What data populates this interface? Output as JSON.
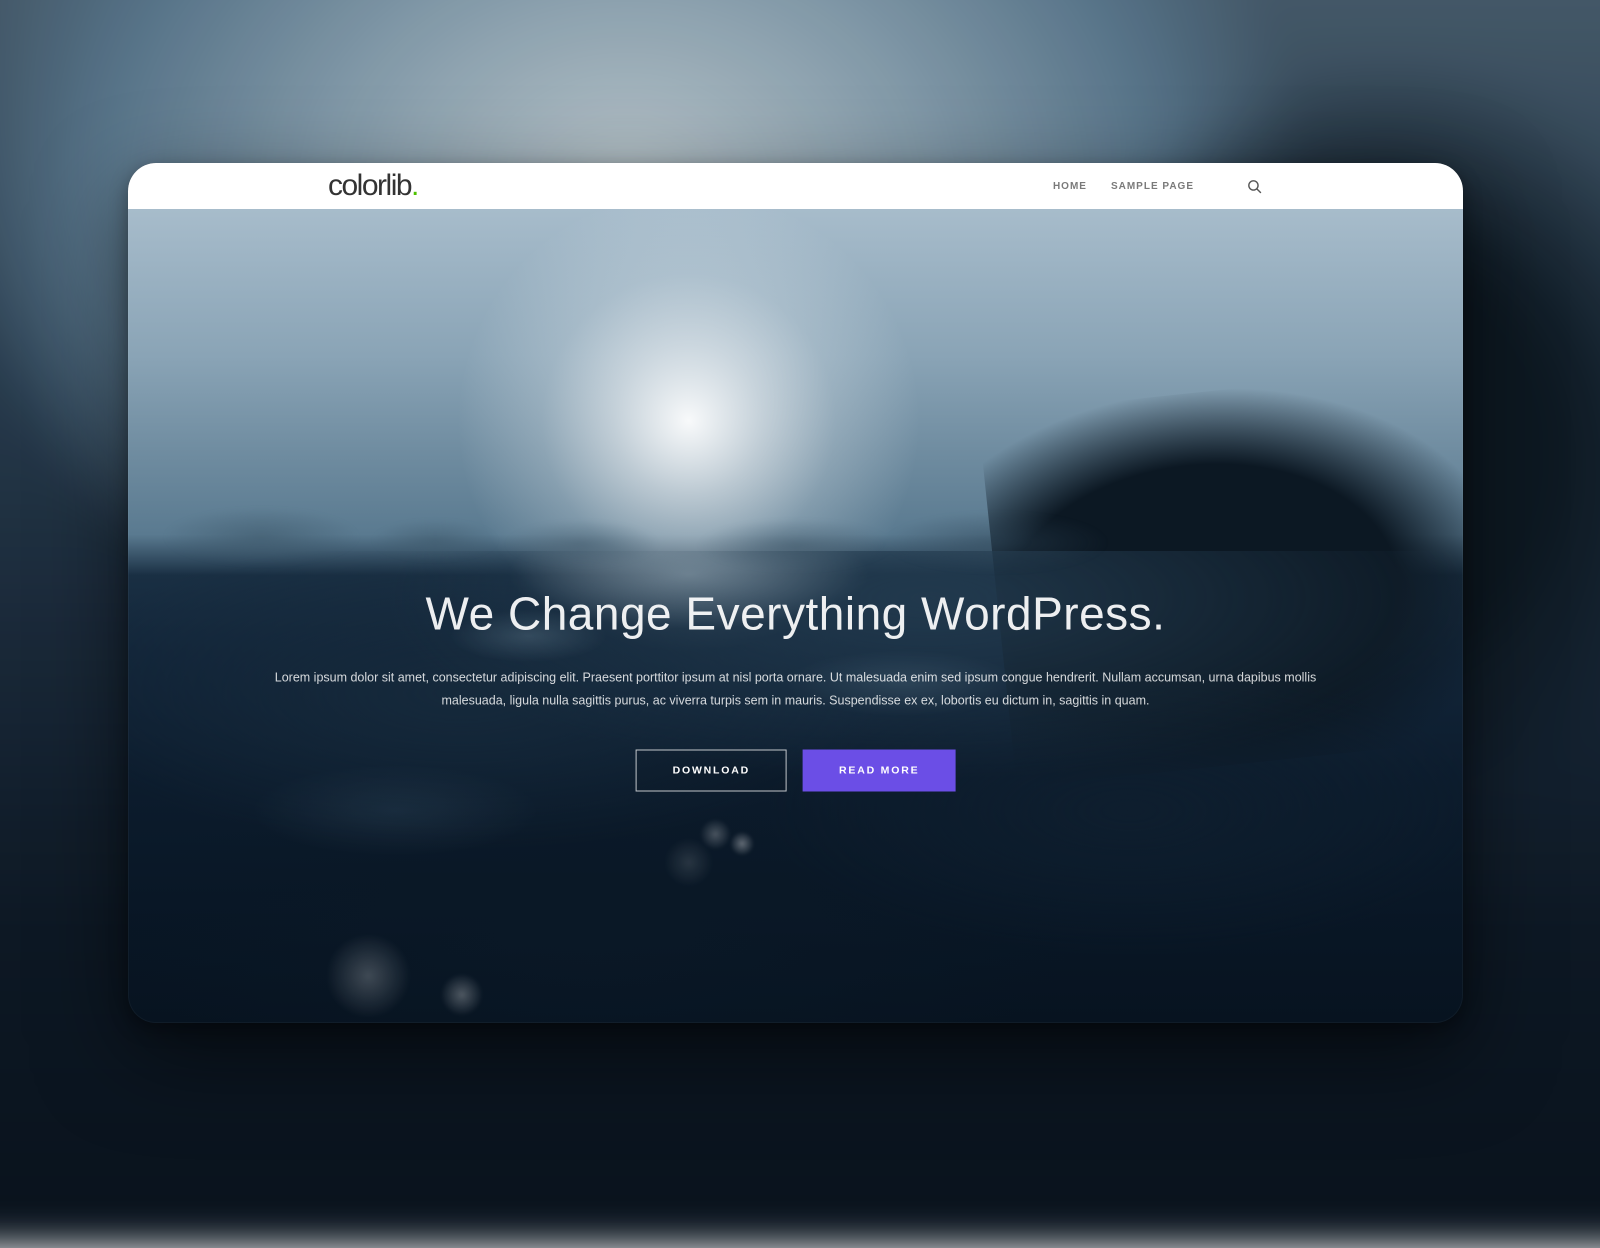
{
  "brand": {
    "name": "colorlib",
    "accent": "."
  },
  "nav": {
    "items": [
      {
        "label": "HOME"
      },
      {
        "label": "SAMPLE PAGE"
      }
    ]
  },
  "hero": {
    "title": "We Change Everything WordPress.",
    "subtitle": "Lorem ipsum dolor sit amet, consectetur adipiscing elit. Praesent porttitor ipsum at nisl porta ornare. Ut malesuada enim sed ipsum congue hendrerit. Nullam accumsan, urna dapibus mollis malesuada, ligula nulla sagittis purus, ac viverra turpis sem in mauris. Suspendisse ex ex, lobortis eu dictum in, sagittis in quam.",
    "buttons": {
      "download": "DOWNLOAD",
      "read_more": "READ MORE"
    }
  },
  "colors": {
    "primary_button": "#6b4ee6",
    "logo_dot": "#4fc200"
  }
}
